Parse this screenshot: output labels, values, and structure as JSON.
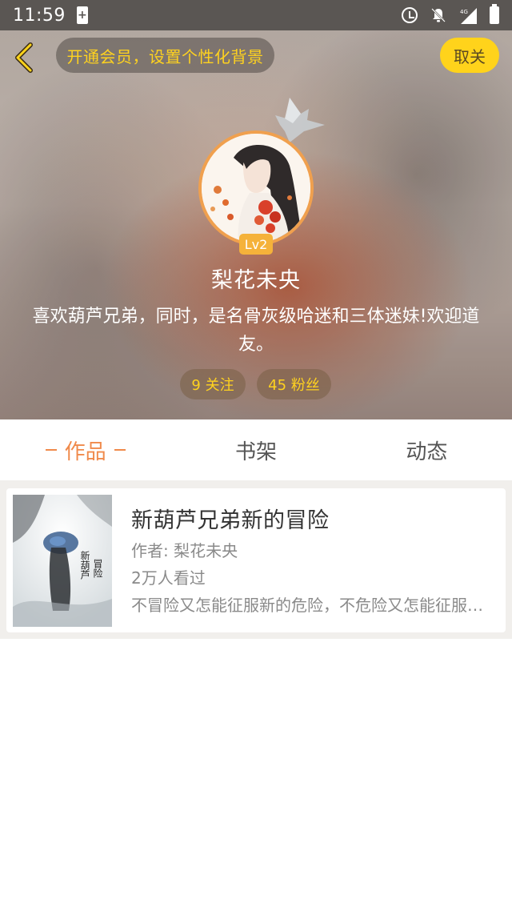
{
  "status_bar": {
    "time": "11:59",
    "network": "4G"
  },
  "header": {
    "vip_banner": "开通会员，设置个性化背景",
    "unfollow_label": "取关"
  },
  "profile": {
    "level": "Lv2",
    "name": "梨花未央",
    "bio": "喜欢葫芦兄弟，同时，是名骨灰级哈迷和三体迷妹!欢迎道友。",
    "following": "9 关注",
    "followers": "45 粉丝"
  },
  "tabs": [
    {
      "label": "作品",
      "active": true
    },
    {
      "label": "书架",
      "active": false
    },
    {
      "label": "动态",
      "active": false
    }
  ],
  "works": [
    {
      "title": "新葫芦兄弟新的冒险",
      "author": "作者: 梨花未央",
      "views": "2万人看过",
      "description": "不冒险又怎能征服新的危险，不危险又怎能征服新的冒险"
    }
  ],
  "colors": {
    "accent": "#f08a4b",
    "vip_text": "#ffd21f",
    "unfollow_bg": "#ffd31b",
    "level_badge": "#f5b23a"
  },
  "icons": {
    "back": "chevron-left-icon",
    "crown": "crown-icon",
    "alarm": "alarm-icon",
    "bell_off": "bell-off-icon",
    "signal": "signal-icon",
    "battery": "battery-icon"
  }
}
